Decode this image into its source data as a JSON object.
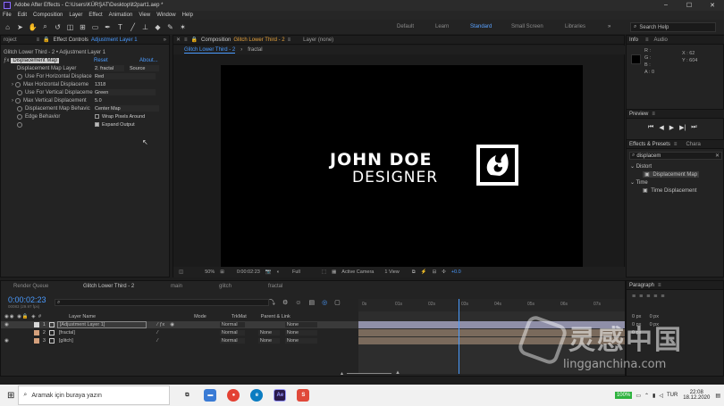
{
  "titlebar": {
    "title": "Adobe After Effects - C:\\Users\\KÜRŞAT\\Desktop\\lt2part1.aep *",
    "min": "–",
    "max": "☐",
    "close": "✕"
  },
  "menu": [
    "File",
    "Edit",
    "Composition",
    "Layer",
    "Effect",
    "Animation",
    "View",
    "Window",
    "Help"
  ],
  "workspaces": {
    "default": "Default",
    "learn": "Learn",
    "standard": "Standard",
    "small_screen": "Small Screen",
    "libraries": "Libraries"
  },
  "search_help": {
    "placeholder": "Search Help"
  },
  "project_tab": "roject",
  "effect_controls": {
    "tab_label": "Effect Controls",
    "tab_layer": "Adjustment Layer 1",
    "path": "Glitch Lower Third - 2 • Adjustment Layer 1",
    "effect_name": "Displacement Map",
    "reset": "Reset",
    "about": "About...",
    "params": [
      {
        "label": "Displacement Map Layer",
        "value": "2. fractal",
        "extra": "Source"
      },
      {
        "label": "Use For Horizontal Displace",
        "value": "Red"
      },
      {
        "label": "Max Horizontal Displaceme",
        "value": "1318"
      },
      {
        "label": "Use For Vertical Displaceme",
        "value": "Green"
      },
      {
        "label": "Max Vertical Displacement",
        "value": "5.0"
      },
      {
        "label": "Displacement Map Behavic",
        "value": "Center Map"
      },
      {
        "label": "Edge Behavior",
        "value": "Wrap Pixels Around"
      },
      {
        "label": "",
        "value": "Expand Output"
      }
    ]
  },
  "composition": {
    "tab_label": "Composition",
    "tab_name": "Glitch Lower Third - 2",
    "layer_tab": "Layer  (none)",
    "sub_tabs": [
      "Glitch Lower Third - 2",
      "fractal"
    ],
    "logo_name": "JOHN DOE",
    "logo_role": "DESIGNER",
    "footer": {
      "zoom": "50%",
      "time": "0:00:02:23",
      "quality": "Full",
      "camera": "Active Camera",
      "view": "1 View",
      "exposure": "+0.0"
    }
  },
  "info": {
    "tab": "Info",
    "audio_tab": "Audio",
    "r": "R :",
    "g": "G :",
    "b": "B :",
    "a": "A : 0",
    "x": "X : 62",
    "y": "Y : 604"
  },
  "preview": {
    "tab": "Preview"
  },
  "effects_presets": {
    "tab": "Effects & Presets",
    "char_tab": "Chara",
    "search_value": "displacem",
    "items": [
      {
        "group": "Distort",
        "effect": "Displacement Map"
      },
      {
        "group": "Time",
        "effect": "Time Displacement"
      }
    ]
  },
  "timeline": {
    "tabs": [
      "Render Queue",
      "Glitch Lower Third - 2",
      "main",
      "glitch",
      "fractal"
    ],
    "current_time": "0:00:02:23",
    "frames_info": "00083 (29.97 fps)",
    "col_layer_name": "Layer Name",
    "col_mode": "Mode",
    "col_trkmat": "TrkMat",
    "col_parent": "Parent & Link",
    "layers": [
      {
        "num": "1",
        "name": "[Adjustment Layer 1]",
        "mode": "Normal",
        "trkmat": "",
        "parent": "None",
        "color": "#d8d8d8"
      },
      {
        "num": "2",
        "name": "[fractal]",
        "mode": "Normal",
        "trkmat": "None",
        "parent": "None",
        "color": "#d4a07c"
      },
      {
        "num": "3",
        "name": "[glitch]",
        "mode": "Normal",
        "trkmat": "None",
        "parent": "None",
        "color": "#d4a07c"
      }
    ],
    "ruler": [
      "0s",
      "01s",
      "02s",
      "03s",
      "04s",
      "05s",
      "06s",
      "07s"
    ],
    "playhead_seconds": 2.93
  },
  "paragraph": {
    "tab": "Paragraph",
    "vals": [
      "0 px",
      "0 px",
      "0 px",
      "0 px",
      "0 px"
    ]
  },
  "taskbar": {
    "search_placeholder": "Aramak için buraya yazın",
    "battery": "100%",
    "lang": "TUR",
    "time": "22:08",
    "date": "18.12.2020"
  },
  "watermark": {
    "cn": "灵感中国",
    "url": "lingganchina.com"
  },
  "colors": {
    "accent": "#4a9bff",
    "ae_brand": "#9999ff"
  }
}
